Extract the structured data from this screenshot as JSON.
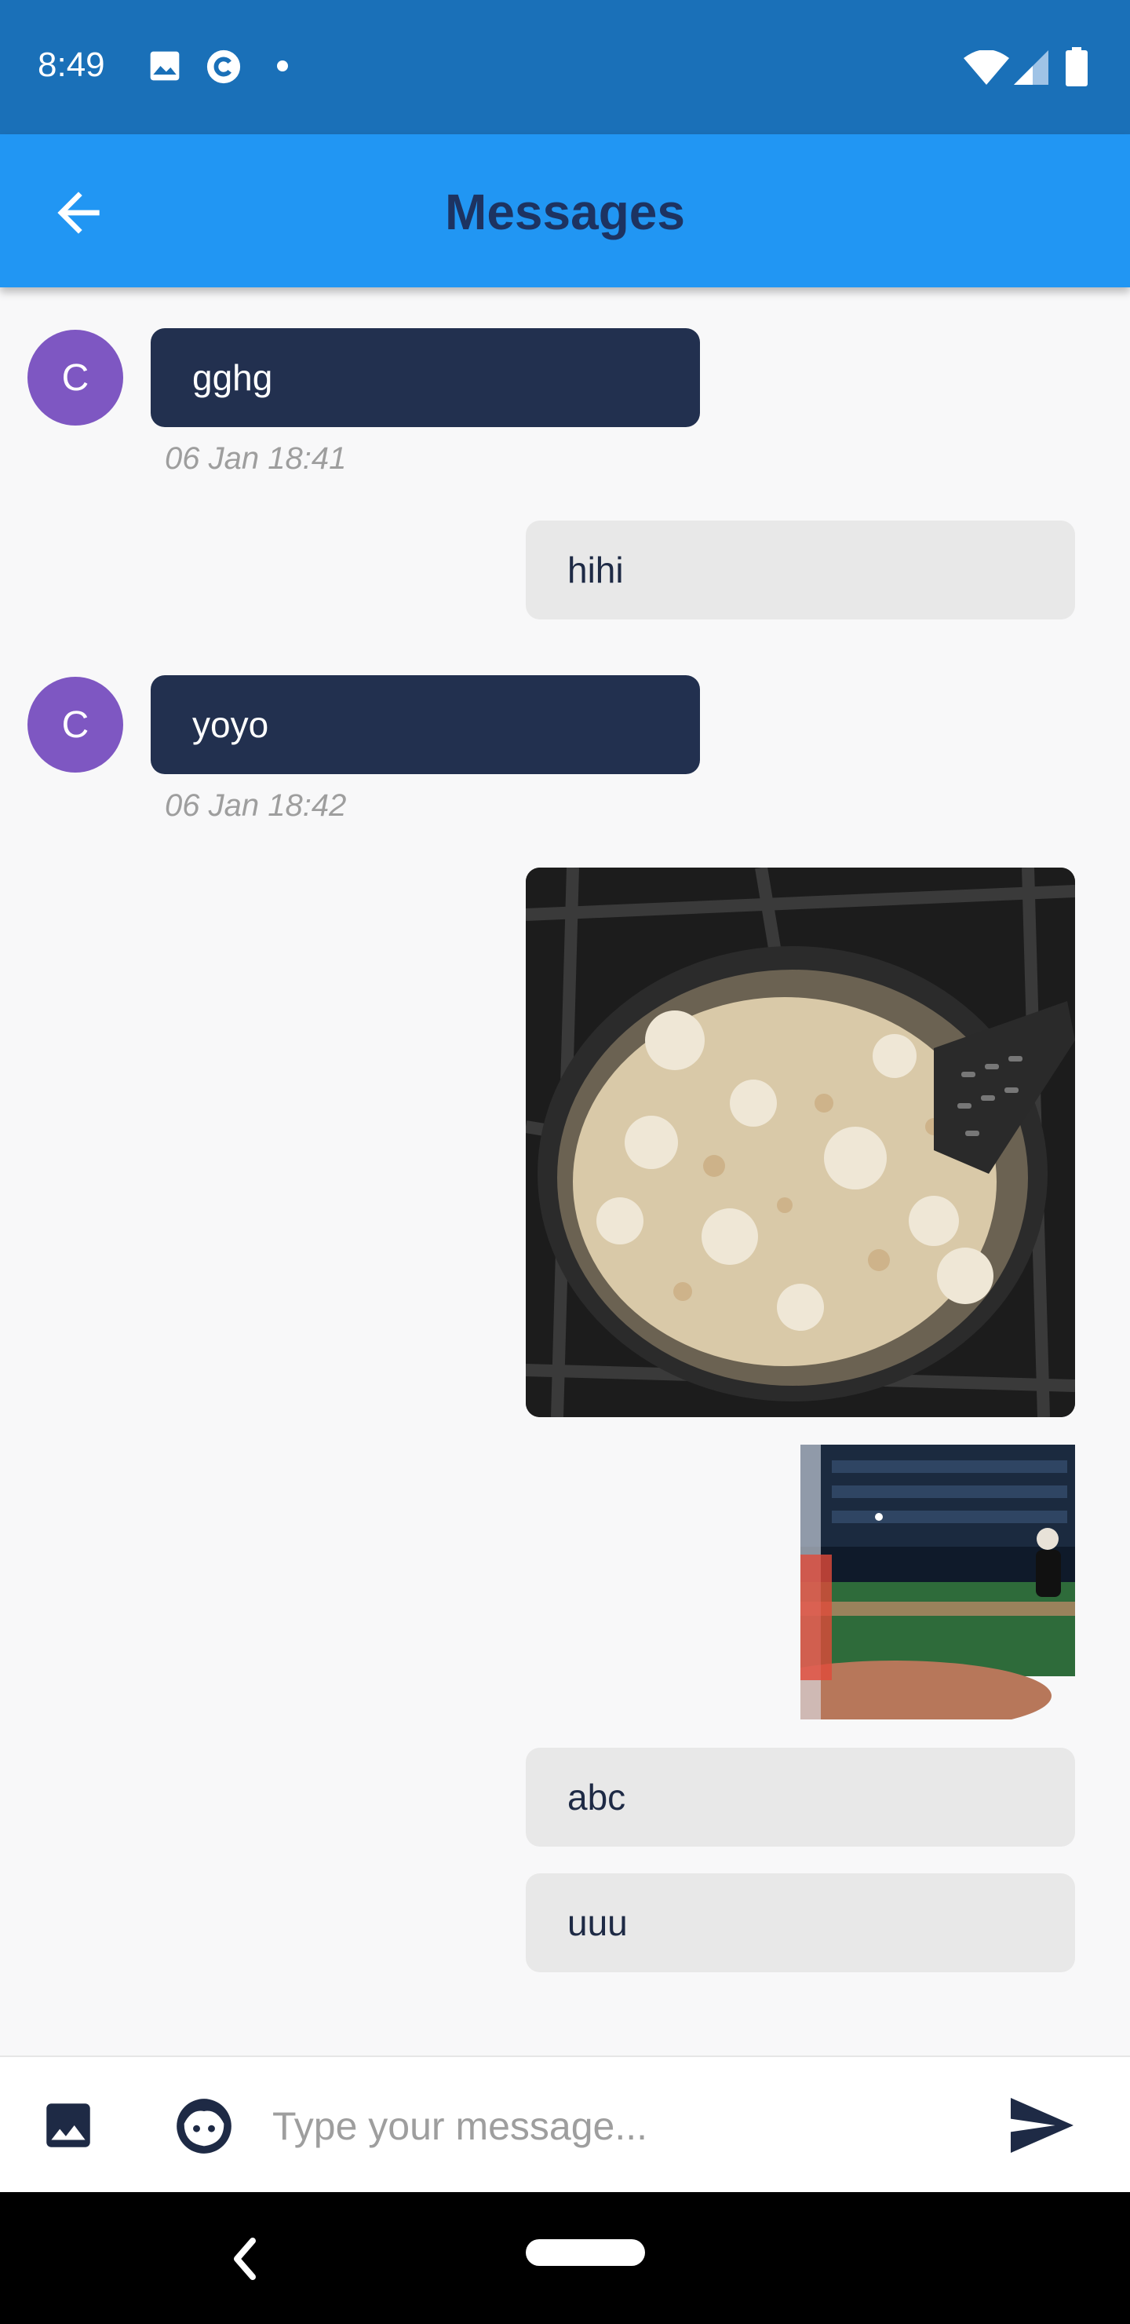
{
  "status_bar": {
    "time": "8:49",
    "icons": [
      "image-icon",
      "circle-c-icon",
      "dot-icon",
      "wifi-icon",
      "signal-icon",
      "battery-icon"
    ]
  },
  "app_bar": {
    "title": "Messages",
    "back_icon": "arrow-back-icon"
  },
  "messages": [
    {
      "direction": "incoming",
      "avatar_letter": "C",
      "text": "gghg",
      "timestamp": "06 Jan 18:41"
    },
    {
      "direction": "outgoing",
      "text": "hihi"
    },
    {
      "direction": "incoming",
      "avatar_letter": "C",
      "text": "yoyo",
      "timestamp": "06 Jan 18:42"
    },
    {
      "direction": "outgoing",
      "type": "image",
      "content": "photo of cauliflower in a frying pan on a stove"
    },
    {
      "direction": "outgoing",
      "type": "image",
      "content": "photo of a baseball game"
    },
    {
      "direction": "outgoing",
      "text": "abc"
    },
    {
      "direction": "outgoing",
      "text": "uuu"
    }
  ],
  "input_bar": {
    "placeholder": "Type your message...",
    "value": "",
    "icons": [
      "image-icon",
      "emoji-face-icon",
      "send-icon"
    ]
  },
  "colors": {
    "status_bar": "#1a70b8",
    "app_bar": "#2196f3",
    "title": "#1d3361",
    "incoming_bubble": "#22304f",
    "outgoing_bubble": "#e8e8e8",
    "avatar": "#7e57c2"
  }
}
